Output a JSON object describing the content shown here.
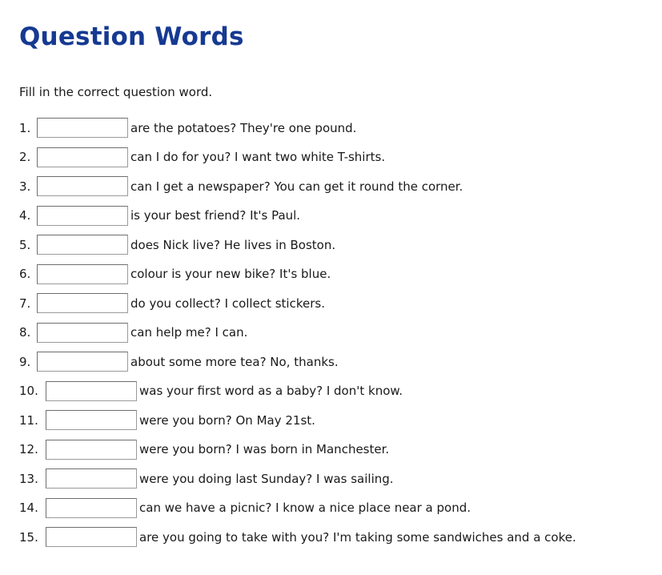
{
  "document": {
    "title": "Question Words",
    "title_color": "#163a92",
    "instruction": "Fill in the correct question word.",
    "background_color": "#ffffff",
    "text_color": "#1a1a1a"
  },
  "exercise": {
    "input_placeholder": "",
    "input_value": "",
    "items": [
      {
        "number": "1.",
        "value": "",
        "sentence": "are the potatoes? They're one pound."
      },
      {
        "number": "2.",
        "value": "",
        "sentence": "can I do for you? I want two white T-shirts."
      },
      {
        "number": "3.",
        "value": "",
        "sentence": "can I get a newspaper? You can get it round the corner."
      },
      {
        "number": "4.",
        "value": "",
        "sentence": "is your best friend? It's Paul."
      },
      {
        "number": "5.",
        "value": "",
        "sentence": "does Nick live? He lives in Boston."
      },
      {
        "number": "6.",
        "value": "",
        "sentence": "colour is your new bike? It's blue."
      },
      {
        "number": "7.",
        "value": "",
        "sentence": "do you collect? I collect stickers."
      },
      {
        "number": "8.",
        "value": "",
        "sentence": "can help me? I can."
      },
      {
        "number": "9.",
        "value": "",
        "sentence": "about some more tea? No, thanks."
      },
      {
        "number": "10.",
        "value": "",
        "sentence": "was your first word as a baby? I don't know."
      },
      {
        "number": "11.",
        "value": "",
        "sentence": "were you born? On May 21st."
      },
      {
        "number": "12.",
        "value": "",
        "sentence": "were you born? I was born in Manchester."
      },
      {
        "number": "13.",
        "value": "",
        "sentence": "were you doing last Sunday? I was sailing."
      },
      {
        "number": "14.",
        "value": "",
        "sentence": "can we have a picnic? I know a nice place near a pond."
      },
      {
        "number": "15.",
        "value": "",
        "sentence": "are you going to take with you? I'm taking some sandwiches and a coke."
      }
    ]
  }
}
